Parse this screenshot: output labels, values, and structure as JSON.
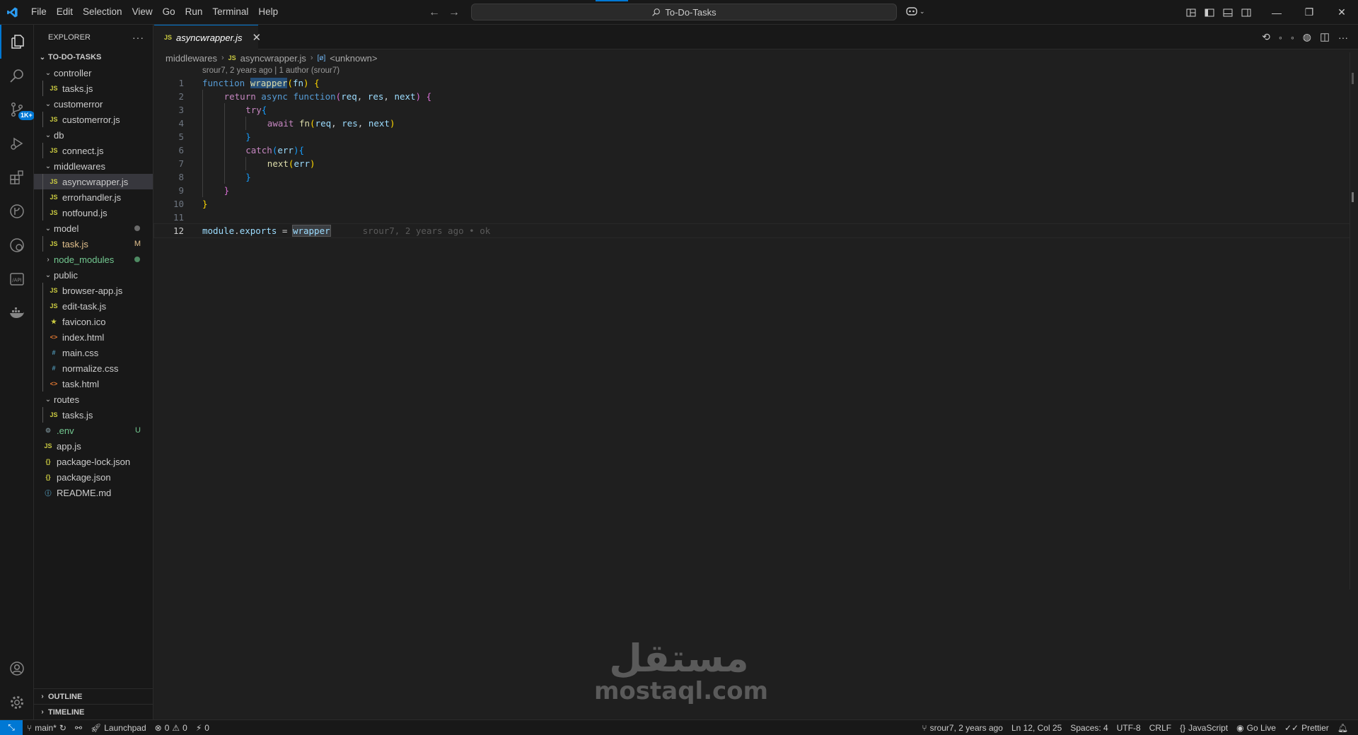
{
  "menu": [
    "File",
    "Edit",
    "Selection",
    "View",
    "Go",
    "Run",
    "Terminal",
    "Help"
  ],
  "command_center": {
    "label": "To-Do-Tasks"
  },
  "activity": {
    "scm_badge": "1K+"
  },
  "sidebar": {
    "title": "EXPLORER",
    "more": "···",
    "root": "TO-DO-TASKS",
    "outline": "OUTLINE",
    "timeline": "TIMELINE",
    "tree": [
      {
        "name": "controller",
        "type": "folder",
        "depth": 1
      },
      {
        "name": "tasks.js",
        "type": "js",
        "depth": 2
      },
      {
        "name": "customerror",
        "type": "folder",
        "depth": 1
      },
      {
        "name": "customerror.js",
        "type": "js",
        "depth": 2
      },
      {
        "name": "db",
        "type": "folder",
        "depth": 1
      },
      {
        "name": "connect.js",
        "type": "js",
        "depth": 2
      },
      {
        "name": "middlewares",
        "type": "folder",
        "depth": 1
      },
      {
        "name": "asyncwrapper.js",
        "type": "js",
        "depth": 2,
        "selected": true
      },
      {
        "name": "errorhandler.js",
        "type": "js",
        "depth": 2
      },
      {
        "name": "notfound.js",
        "type": "js",
        "depth": 2
      },
      {
        "name": "model",
        "type": "folder",
        "depth": 1,
        "dot": "#6b6b6b"
      },
      {
        "name": "task.js",
        "type": "js",
        "depth": 2,
        "status": "M",
        "color": "#e2c08d"
      },
      {
        "name": "node_modules",
        "type": "folder",
        "depth": 1,
        "collapsed": true,
        "dot": "#4e8a62",
        "color": "#73c991"
      },
      {
        "name": "public",
        "type": "folder",
        "depth": 1
      },
      {
        "name": "browser-app.js",
        "type": "js",
        "depth": 2
      },
      {
        "name": "edit-task.js",
        "type": "js",
        "depth": 2
      },
      {
        "name": "favicon.ico",
        "type": "ico",
        "depth": 2
      },
      {
        "name": "index.html",
        "type": "html",
        "depth": 2
      },
      {
        "name": "main.css",
        "type": "css",
        "depth": 2
      },
      {
        "name": "normalize.css",
        "type": "css",
        "depth": 2
      },
      {
        "name": "task.html",
        "type": "html",
        "depth": 2
      },
      {
        "name": "routes",
        "type": "folder",
        "depth": 1
      },
      {
        "name": "tasks.js",
        "type": "js",
        "depth": 2
      },
      {
        "name": ".env",
        "type": "env",
        "depth": 0,
        "status": "U",
        "color": "#73c991"
      },
      {
        "name": "app.js",
        "type": "js",
        "depth": 0
      },
      {
        "name": "package-lock.json",
        "type": "json",
        "depth": 0
      },
      {
        "name": "package.json",
        "type": "json",
        "depth": 0
      },
      {
        "name": "README.md",
        "type": "md",
        "depth": 0
      }
    ]
  },
  "icons": {
    "js": "JS",
    "json": "{}",
    "html": "<>",
    "css": "#",
    "ico": "★",
    "env": "⚙",
    "md": "ⓘ"
  },
  "editor": {
    "tab": {
      "icon": "JS",
      "label": "asyncwrapper.js",
      "close": "✕"
    },
    "breadcrumb": {
      "folder": "middlewares",
      "file_icon": "JS",
      "file": "asyncwrapper.js",
      "symbol_icon": "[ø]",
      "symbol": "<unknown>"
    },
    "codelens": "srour7, 2 years ago | 1 author (srour7)",
    "lines": [
      {
        "n": "1",
        "tokens": [
          [
            "k",
            "function "
          ],
          [
            "f hl",
            "wrapper"
          ],
          [
            "b1",
            "("
          ],
          [
            "v",
            "fn"
          ],
          [
            "b1",
            ")"
          ],
          [
            "p",
            " "
          ],
          [
            "b1",
            "{"
          ]
        ]
      },
      {
        "n": "2",
        "indent": 1,
        "tokens": [
          [
            "kc",
            "return "
          ],
          [
            "k",
            "async "
          ],
          [
            "k",
            "function"
          ],
          [
            "b2",
            "("
          ],
          [
            "v",
            "req"
          ],
          [
            "p",
            ", "
          ],
          [
            "v",
            "res"
          ],
          [
            "p",
            ", "
          ],
          [
            "v",
            "next"
          ],
          [
            "b2",
            ")"
          ],
          [
            "p",
            " "
          ],
          [
            "b2",
            "{"
          ]
        ]
      },
      {
        "n": "3",
        "indent": 2,
        "tokens": [
          [
            "kc",
            "try"
          ],
          [
            "b3",
            "{"
          ]
        ]
      },
      {
        "n": "4",
        "indent": 3,
        "tokens": [
          [
            "kc",
            "await "
          ],
          [
            "f",
            "fn"
          ],
          [
            "b1",
            "("
          ],
          [
            "v",
            "req"
          ],
          [
            "p",
            ", "
          ],
          [
            "v",
            "res"
          ],
          [
            "p",
            ", "
          ],
          [
            "v",
            "next"
          ],
          [
            "b1",
            ")"
          ]
        ]
      },
      {
        "n": "5",
        "indent": 2,
        "tokens": [
          [
            "b3",
            "}"
          ]
        ]
      },
      {
        "n": "6",
        "indent": 2,
        "tokens": [
          [
            "kc",
            "catch"
          ],
          [
            "b3",
            "("
          ],
          [
            "v",
            "err"
          ],
          [
            "b3",
            ")"
          ],
          [
            "b3",
            "{"
          ]
        ]
      },
      {
        "n": "7",
        "indent": 3,
        "tokens": [
          [
            "f",
            "next"
          ],
          [
            "b1",
            "("
          ],
          [
            "v",
            "err"
          ],
          [
            "b1",
            ")"
          ]
        ]
      },
      {
        "n": "8",
        "indent": 2,
        "tokens": [
          [
            "b3",
            "}"
          ]
        ]
      },
      {
        "n": "9",
        "indent": 1,
        "tokens": [
          [
            "b2",
            "}"
          ]
        ]
      },
      {
        "n": "10",
        "tokens": [
          [
            "b1",
            "}"
          ]
        ]
      },
      {
        "n": "11",
        "tokens": []
      },
      {
        "n": "12",
        "current": true,
        "tokens": [
          [
            "v",
            "module"
          ],
          [
            "p",
            "."
          ],
          [
            "v",
            "exports"
          ],
          [
            "p",
            " = "
          ],
          [
            "v hl2",
            "wrapper"
          ]
        ],
        "blame": "srour7, 2 years ago • ok"
      }
    ]
  },
  "statusbar": {
    "branch": "main*",
    "launchpad": "Launchpad",
    "errors": "0",
    "warnings": "0",
    "ports": "0",
    "blame": "srour7, 2 years ago",
    "position": "Ln 12, Col 25",
    "spaces": "Spaces: 4",
    "encoding": "UTF-8",
    "eol": "CRLF",
    "language": "JavaScript",
    "golive": "Go Live",
    "prettier": "Prettier"
  },
  "watermark": {
    "arabic": "مستقل",
    "latin": "mostaql.com"
  }
}
